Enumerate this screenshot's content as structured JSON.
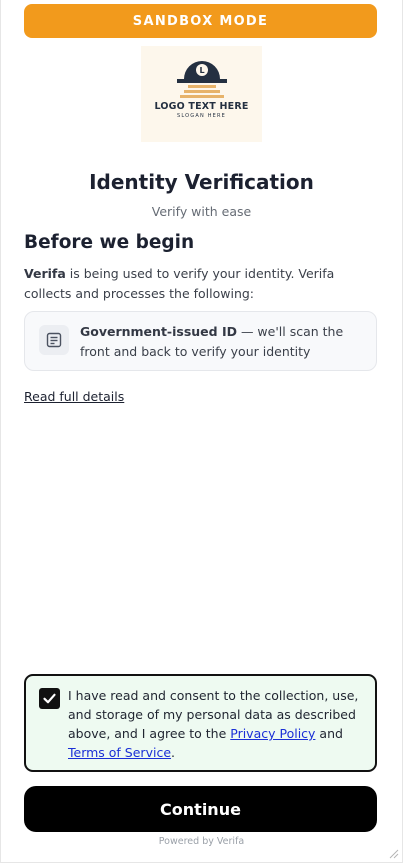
{
  "banner": {
    "label": "SANDBOX MODE",
    "color": "#f29a1c"
  },
  "logo": {
    "text": "LOGO TEXT HERE",
    "slogan": "SLOGAN HERE",
    "mark": "L"
  },
  "header": {
    "title": "Identity Verification",
    "subtitle": "Verify with ease"
  },
  "intro": {
    "heading": "Before we begin",
    "brand": "Verifa",
    "text_after_brand": " is being used to verify your identity. Verifa collects and processes the following:"
  },
  "requirements": [
    {
      "icon": "document-icon",
      "title": "Government-issued ID",
      "description": " — we'll scan the front and back to verify your identity"
    }
  ],
  "read_full_details": "Read full details",
  "consent": {
    "checked": true,
    "text_before": "I have read and consent to the collection, use, and storage of my personal data as described above, and I agree to the ",
    "privacy_link": "Privacy Policy",
    "and": " and ",
    "terms_link": "Terms of Service",
    "period": ".",
    "background_color": "#eefaf1"
  },
  "continue_label": "Continue",
  "powered_by": "Powered by Verifa"
}
